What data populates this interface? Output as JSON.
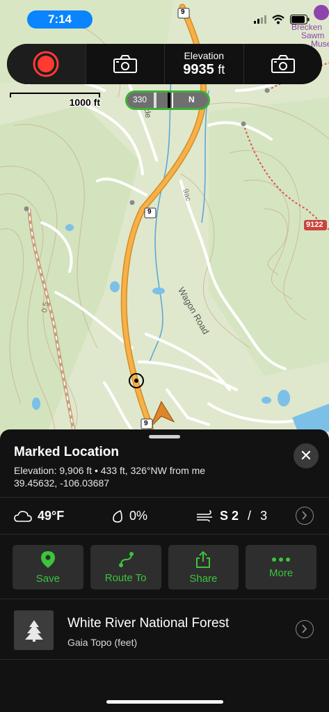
{
  "status_bar": {
    "time": "7:14"
  },
  "map": {
    "route_shield": "9",
    "road_label_wagon": "Wagon Road",
    "road_label_cycle": "cle",
    "road_label_other": "9ac",
    "contour_label": "0.5",
    "elevation_marker": "9122",
    "place_label_line1": "Brecken",
    "place_label_line2": "Sawm",
    "place_label_line3": "Museu",
    "scale_label": "1000 ft",
    "compass_heading": "330",
    "compass_north": "N"
  },
  "toolbar": {
    "elevation_label": "Elevation",
    "elevation_value": "9935",
    "elevation_unit": "ft"
  },
  "sheet": {
    "title": "Marked Location",
    "elevation_line": "Elevation: 9,906 ft • 433 ft, 326°NW from me",
    "coords_line": "39.45632, -106.03687",
    "close_label": "✕",
    "weather": {
      "temperature": "49°F",
      "precip": "0%",
      "wind_dir": "S",
      "wind_speed": "2",
      "wind_sep": " / ",
      "wind_gust": "3"
    },
    "actions": [
      {
        "label": "Save",
        "icon": "map-pin-icon"
      },
      {
        "label": "Route To",
        "icon": "route-icon"
      },
      {
        "label": "Share",
        "icon": "share-icon"
      },
      {
        "label": "More",
        "icon": "more-dots-icon"
      }
    ],
    "info": {
      "title": "White River National Forest",
      "subtitle": "Gaia Topo (feet)",
      "icon": "tree-icon"
    }
  },
  "colors": {
    "accent_green": "#3cc43c",
    "record_red": "#ff3b30",
    "highway_orange": "#f5a623",
    "time_pill_blue": "#0a84ff"
  }
}
